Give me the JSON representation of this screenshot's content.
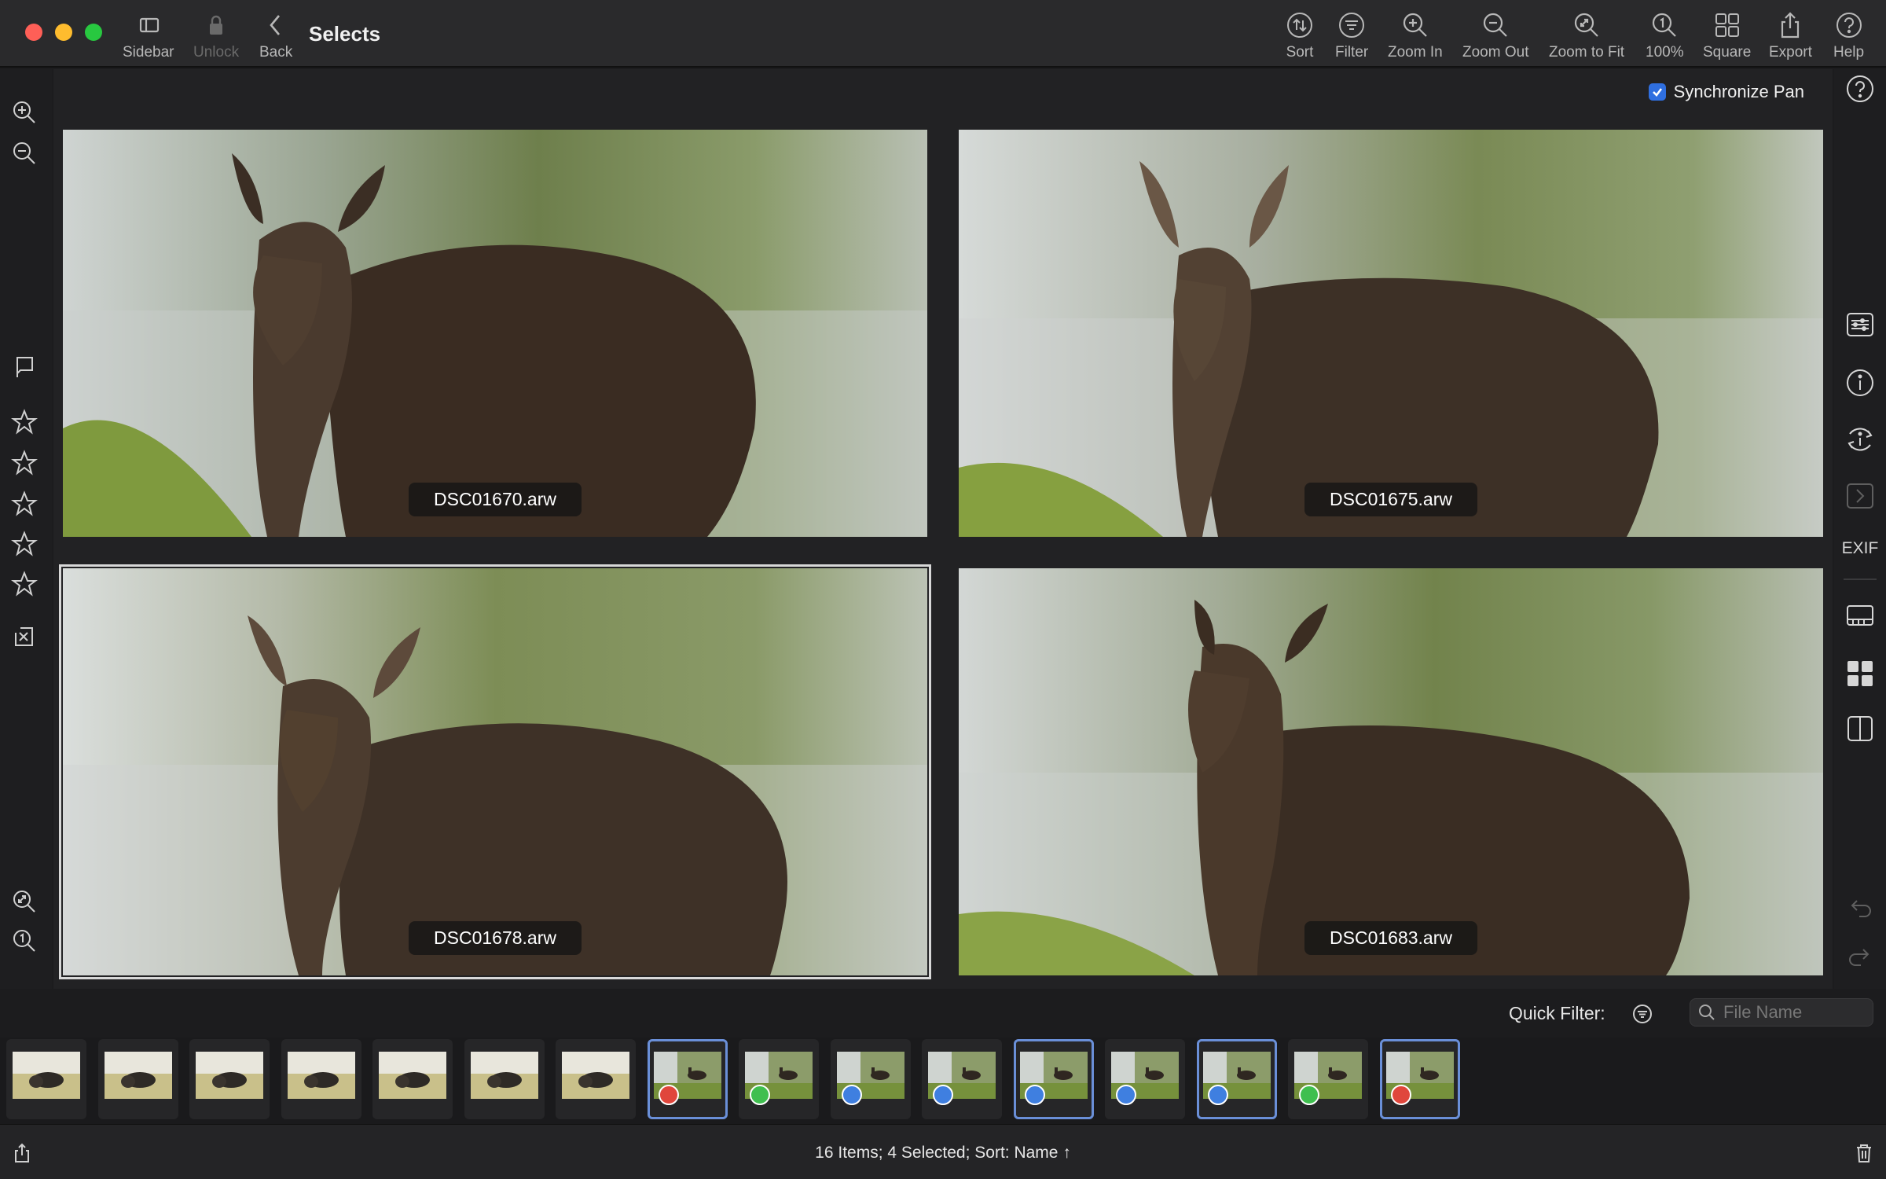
{
  "window": {
    "title": "Selects"
  },
  "toolbar": {
    "left": [
      {
        "label": "Sidebar",
        "icon": "sidebar-icon"
      },
      {
        "label": "Unlock",
        "icon": "lock-icon",
        "disabled": true
      },
      {
        "label": "Back",
        "icon": "chevron-left-icon"
      }
    ],
    "right": [
      {
        "label": "Sort",
        "icon": "sort-icon"
      },
      {
        "label": "Filter",
        "icon": "filter-icon"
      },
      {
        "label": "Zoom In",
        "icon": "zoom-in-icon"
      },
      {
        "label": "Zoom Out",
        "icon": "zoom-out-icon"
      },
      {
        "label": "Zoom to Fit",
        "icon": "zoom-fit-icon"
      },
      {
        "label": "100%",
        "icon": "zoom-100-icon"
      },
      {
        "label": "Square",
        "icon": "square-grid-icon"
      },
      {
        "label": "Export",
        "icon": "share-icon"
      },
      {
        "label": "Help",
        "icon": "help-icon"
      }
    ]
  },
  "sync_pan": {
    "label": "Synchronize Pan",
    "checked": true
  },
  "photos": [
    {
      "filename": "DSC01670.arw",
      "selected": false
    },
    {
      "filename": "DSC01675.arw",
      "selected": false
    },
    {
      "filename": "DSC01678.arw",
      "selected": true
    },
    {
      "filename": "DSC01683.arw",
      "selected": false
    }
  ],
  "right_sidebar": {
    "exif_label": "EXIF"
  },
  "quick_filter": {
    "label": "Quick Filter:",
    "search_placeholder": "File Name"
  },
  "filmstrip": [
    {
      "subject": "bison",
      "label_color": null,
      "selected": false
    },
    {
      "subject": "bison",
      "label_color": null,
      "selected": false
    },
    {
      "subject": "bison",
      "label_color": null,
      "selected": false
    },
    {
      "subject": "bison",
      "label_color": null,
      "selected": false
    },
    {
      "subject": "bison",
      "label_color": null,
      "selected": false
    },
    {
      "subject": "bison",
      "label_color": null,
      "selected": false
    },
    {
      "subject": "bison",
      "label_color": null,
      "selected": false
    },
    {
      "subject": "moose",
      "label_color": "#e0463c",
      "selected": true
    },
    {
      "subject": "moose",
      "label_color": "#3fbf4f",
      "selected": false
    },
    {
      "subject": "moose",
      "label_color": "#3f7fe0",
      "selected": false
    },
    {
      "subject": "moose",
      "label_color": "#3f7fe0",
      "selected": false
    },
    {
      "subject": "moose",
      "label_color": "#3f7fe0",
      "selected": true
    },
    {
      "subject": "moose",
      "label_color": "#3f7fe0",
      "selected": false
    },
    {
      "subject": "moose",
      "label_color": "#3f7fe0",
      "selected": true
    },
    {
      "subject": "moose",
      "label_color": "#3fbf4f",
      "selected": false
    },
    {
      "subject": "moose",
      "label_color": "#e0463c",
      "selected": true
    }
  ],
  "status": {
    "text": "16 Items; 4 Selected; Sort: Name ↑"
  },
  "colors": {
    "accent": "#2f6fe0",
    "selection_outline": "#6a8fd8"
  }
}
